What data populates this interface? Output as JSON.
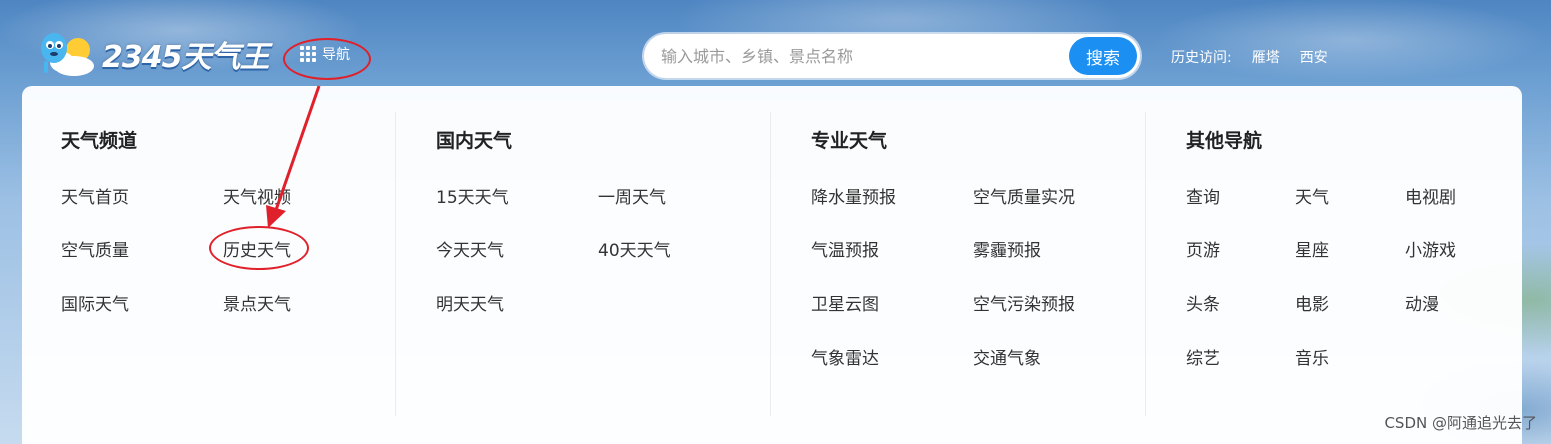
{
  "header": {
    "logo_text": "2345天气王",
    "nav_label": "导航",
    "search": {
      "placeholder": "输入城市、乡镇、景点名称",
      "button": "搜索"
    },
    "history": {
      "label": "历史访问:",
      "items": [
        "雁塔",
        "西安"
      ]
    }
  },
  "nav_panel": {
    "columns": [
      {
        "title": "天气频道",
        "links": [
          "天气首页",
          "天气视频",
          "空气质量",
          "历史天气",
          "国际天气",
          "景点天气"
        ]
      },
      {
        "title": "国内天气",
        "links": [
          "15天天气",
          "一周天气",
          "今天天气",
          "40天天气",
          "明天天气"
        ]
      },
      {
        "title": "专业天气",
        "links": [
          "降水量预报",
          "空气质量实况",
          "气温预报",
          "雾霾预报",
          "卫星云图",
          "空气污染预报",
          "气象雷达",
          "交通气象"
        ]
      },
      {
        "title": "其他导航",
        "links": [
          "查询",
          "天气",
          "电视剧",
          "页游",
          "星座",
          "小游戏",
          "头条",
          "电影",
          "动漫",
          "综艺",
          "音乐"
        ]
      }
    ]
  },
  "watermark": "CSDN @阿通追光去了",
  "colors": {
    "accent": "#1b8ff2",
    "annotation": "#e0202a"
  }
}
